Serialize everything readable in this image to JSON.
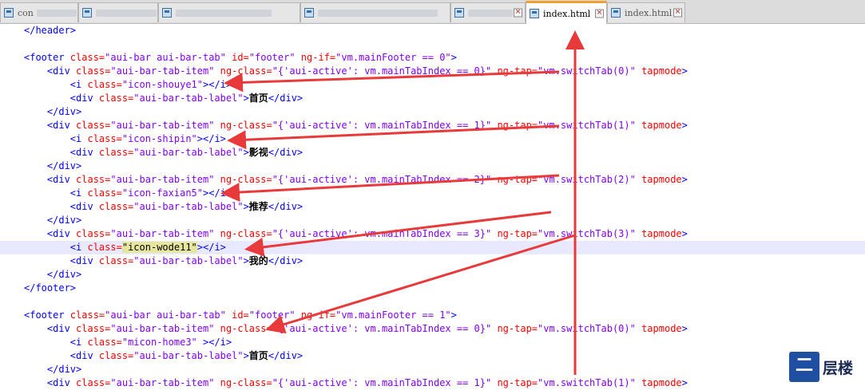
{
  "tabs": [
    {
      "label": "con",
      "active": false,
      "blurred": true
    },
    {
      "label": "",
      "active": false,
      "blurred": true
    },
    {
      "label": "",
      "active": false,
      "blurred": true
    },
    {
      "label": "",
      "active": false,
      "blurred": true
    },
    {
      "label": "",
      "active": false,
      "blurred": true
    },
    {
      "label": "index.html",
      "active": true,
      "blurred": false
    },
    {
      "label": "index.html",
      "active": false,
      "blurred": false
    }
  ],
  "code_lines": [
    {
      "indent": 0,
      "tokens": [
        [
          "tag",
          "</header>"
        ]
      ]
    },
    {
      "indent": 0,
      "tokens": []
    },
    {
      "indent": 0,
      "tokens": [
        [
          "tag",
          "<footer "
        ],
        [
          "attr",
          "class="
        ],
        [
          "val",
          "\"aui-bar aui-bar-tab\""
        ],
        [
          "attr",
          " id="
        ],
        [
          "val",
          "\"footer\""
        ],
        [
          "attr",
          " ng-if="
        ],
        [
          "val",
          "\"vm.mainFooter == 0\""
        ],
        [
          "tag",
          ">"
        ]
      ]
    },
    {
      "indent": 4,
      "tokens": [
        [
          "tag",
          "<div "
        ],
        [
          "attr",
          "class="
        ],
        [
          "val",
          "\"aui-bar-tab-item\""
        ],
        [
          "attr",
          " ng-class="
        ],
        [
          "val",
          "\"{'aui-active': vm.mainTabIndex == 0}\""
        ],
        [
          "attr",
          " ng-tap="
        ],
        [
          "val",
          "\"vm.switchTab(0)\""
        ],
        [
          "attr",
          " tapmode"
        ],
        [
          "tag",
          ">"
        ]
      ]
    },
    {
      "indent": 8,
      "tokens": [
        [
          "tag",
          "<i "
        ],
        [
          "attr",
          "class="
        ],
        [
          "val",
          "\"icon-shouye1\""
        ],
        [
          "tag",
          "></i>"
        ]
      ]
    },
    {
      "indent": 8,
      "tokens": [
        [
          "tag",
          "<div "
        ],
        [
          "attr",
          "class="
        ],
        [
          "val",
          "\"aui-bar-tab-label\""
        ],
        [
          "tag",
          ">"
        ],
        [
          "bold",
          "首页"
        ],
        [
          "tag",
          "</div>"
        ]
      ]
    },
    {
      "indent": 4,
      "tokens": [
        [
          "tag",
          "</div>"
        ]
      ]
    },
    {
      "indent": 4,
      "tokens": [
        [
          "tag",
          "<div "
        ],
        [
          "attr",
          "class="
        ],
        [
          "val",
          "\"aui-bar-tab-item\""
        ],
        [
          "attr",
          " ng-class="
        ],
        [
          "val",
          "\"{'aui-active': vm.mainTabIndex == 1}\""
        ],
        [
          "attr",
          " ng-tap="
        ],
        [
          "val",
          "\"vm.switchTab(1)\""
        ],
        [
          "attr",
          " tapmode"
        ],
        [
          "tag",
          ">"
        ]
      ]
    },
    {
      "indent": 8,
      "tokens": [
        [
          "tag",
          "<i "
        ],
        [
          "attr",
          "class="
        ],
        [
          "val",
          "\"icon-shipin\""
        ],
        [
          "tag",
          "></i>"
        ]
      ]
    },
    {
      "indent": 8,
      "tokens": [
        [
          "tag",
          "<div "
        ],
        [
          "attr",
          "class="
        ],
        [
          "val",
          "\"aui-bar-tab-label\""
        ],
        [
          "tag",
          ">"
        ],
        [
          "bold",
          "影视"
        ],
        [
          "tag",
          "</div>"
        ]
      ]
    },
    {
      "indent": 4,
      "tokens": [
        [
          "tag",
          "</div>"
        ]
      ]
    },
    {
      "indent": 4,
      "tokens": [
        [
          "tag",
          "<div "
        ],
        [
          "attr",
          "class="
        ],
        [
          "val",
          "\"aui-bar-tab-item\""
        ],
        [
          "attr",
          " ng-class="
        ],
        [
          "val",
          "\"{'aui-active': vm.mainTabIndex == 2}\""
        ],
        [
          "attr",
          " ng-tap="
        ],
        [
          "val",
          "\"vm.switchTab(2)\""
        ],
        [
          "attr",
          " tapmode"
        ],
        [
          "tag",
          ">"
        ]
      ]
    },
    {
      "indent": 8,
      "tokens": [
        [
          "tag",
          "<i "
        ],
        [
          "attr",
          "class="
        ],
        [
          "val",
          "\"icon-faxian5\""
        ],
        [
          "tag",
          "></i>"
        ]
      ]
    },
    {
      "indent": 8,
      "tokens": [
        [
          "tag",
          "<div "
        ],
        [
          "attr",
          "class="
        ],
        [
          "val",
          "\"aui-bar-tab-label\""
        ],
        [
          "tag",
          ">"
        ],
        [
          "bold",
          "推荐"
        ],
        [
          "tag",
          "</div>"
        ]
      ]
    },
    {
      "indent": 4,
      "tokens": [
        [
          "tag",
          "</div>"
        ]
      ]
    },
    {
      "indent": 4,
      "tokens": [
        [
          "tag",
          "<div "
        ],
        [
          "attr",
          "class="
        ],
        [
          "val",
          "\"aui-bar-tab-item\""
        ],
        [
          "attr",
          " ng-class="
        ],
        [
          "val",
          "\"{'aui-active': vm.mainTabIndex == 3}\""
        ],
        [
          "attr",
          " ng-tap="
        ],
        [
          "val",
          "\"vm.switchTab(3)\""
        ],
        [
          "attr",
          " tapmode"
        ],
        [
          "tag",
          ">"
        ]
      ]
    },
    {
      "indent": 8,
      "highlight": true,
      "tokens": [
        [
          "tag",
          "<i "
        ],
        [
          "attr",
          "class="
        ],
        [
          "selval",
          "\"icon-wode11\""
        ],
        [
          "tag",
          "></i>"
        ]
      ]
    },
    {
      "indent": 8,
      "tokens": [
        [
          "tag",
          "<div "
        ],
        [
          "attr",
          "class="
        ],
        [
          "val",
          "\"aui-bar-tab-label\""
        ],
        [
          "tag",
          ">"
        ],
        [
          "bold",
          "我的"
        ],
        [
          "tag",
          "</div>"
        ]
      ]
    },
    {
      "indent": 4,
      "tokens": [
        [
          "tag",
          "</div>"
        ]
      ]
    },
    {
      "indent": 0,
      "tokens": [
        [
          "tag",
          "</footer>"
        ]
      ]
    },
    {
      "indent": 0,
      "tokens": []
    },
    {
      "indent": 0,
      "tokens": [
        [
          "tag",
          "<footer "
        ],
        [
          "attr",
          "class="
        ],
        [
          "val",
          "\"aui-bar aui-bar-tab\""
        ],
        [
          "attr",
          " id="
        ],
        [
          "val",
          "\"footer\""
        ],
        [
          "attr",
          " ng-if="
        ],
        [
          "val",
          "\"vm.mainFooter == 1\""
        ],
        [
          "tag",
          ">"
        ]
      ]
    },
    {
      "indent": 4,
      "tokens": [
        [
          "tag",
          "<div "
        ],
        [
          "attr",
          "class="
        ],
        [
          "val",
          "\"aui-bar-tab-item\""
        ],
        [
          "attr",
          " ng-class="
        ],
        [
          "val",
          "\"{'aui-active': vm.mainTabIndex == 0}\""
        ],
        [
          "attr",
          " ng-tap="
        ],
        [
          "val",
          "\"vm.switchTab(0)\""
        ],
        [
          "attr",
          " tapmode"
        ],
        [
          "tag",
          ">"
        ]
      ]
    },
    {
      "indent": 8,
      "tokens": [
        [
          "tag",
          "<i "
        ],
        [
          "attr",
          "class="
        ],
        [
          "val",
          "\"micon-home3\""
        ],
        [
          "tag",
          " ></i>"
        ]
      ]
    },
    {
      "indent": 8,
      "tokens": [
        [
          "tag",
          "<div "
        ],
        [
          "attr",
          "class="
        ],
        [
          "val",
          "\"aui-bar-tab-label\""
        ],
        [
          "tag",
          ">"
        ],
        [
          "bold",
          "首页"
        ],
        [
          "tag",
          "</div>"
        ]
      ]
    },
    {
      "indent": 4,
      "tokens": [
        [
          "tag",
          "</div>"
        ]
      ]
    },
    {
      "indent": 4,
      "tokens": [
        [
          "tag",
          "<div "
        ],
        [
          "attr",
          "class="
        ],
        [
          "val",
          "\"aui-bar-tab-item\""
        ],
        [
          "attr",
          " ng-class="
        ],
        [
          "val",
          "\"{'aui-active': vm.mainTabIndex == 1}\""
        ],
        [
          "attr",
          " ng-tap="
        ],
        [
          "val",
          "\"vm.switchTab(1)\""
        ],
        [
          "attr",
          " tapmode"
        ],
        [
          "tag",
          ">"
        ]
      ]
    }
  ],
  "annotation_color": "#e8393b",
  "watermark": {
    "mark": "二",
    "brand": "层楼"
  }
}
